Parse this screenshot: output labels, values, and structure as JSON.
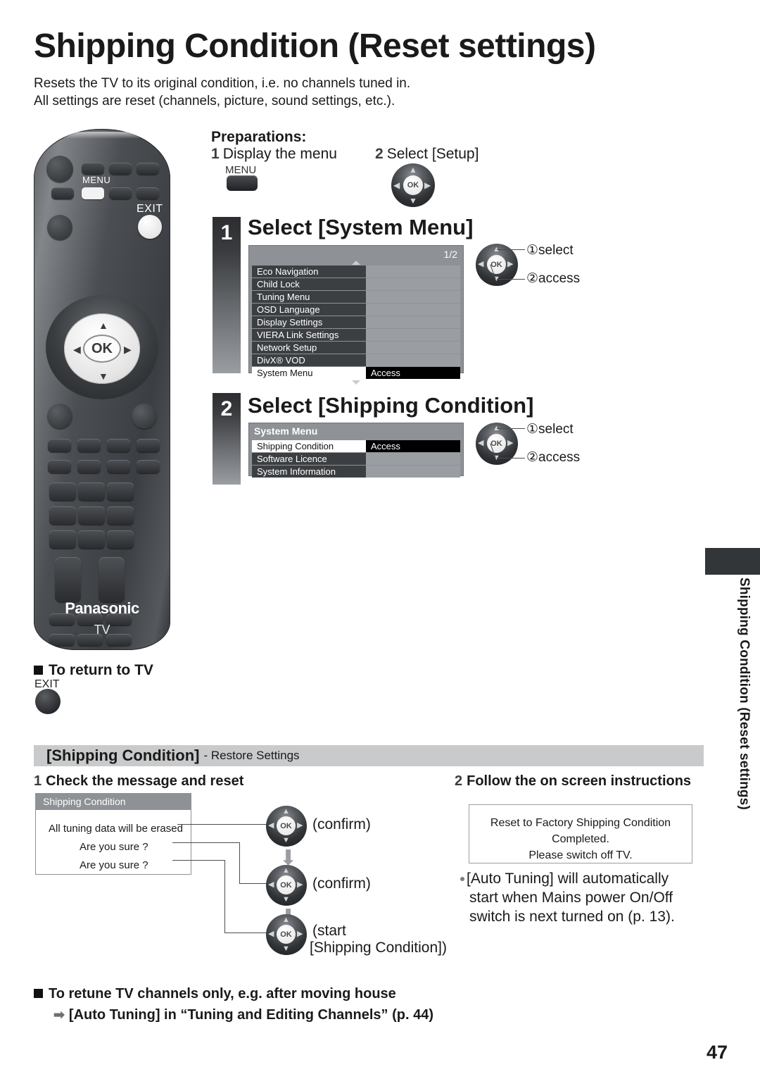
{
  "header": {
    "title": "Shipping Condition (Reset settings)",
    "intro_line1": "Resets the TV to its original condition, i.e. no channels tuned in.",
    "intro_line2": "All settings are reset (channels, picture, sound settings, etc.)."
  },
  "remote": {
    "menu_label": "MENU",
    "exit_label": "EXIT",
    "ok_label": "OK",
    "brand": "Panasonic",
    "brand_sub": "TV"
  },
  "preparations": {
    "title": "Preparations:",
    "step1_num": "1",
    "step1_text": "Display the menu",
    "menu_key_label": "MENU",
    "step2_num": "2",
    "step2_text": "Select [Setup]",
    "ok_label": "OK"
  },
  "step1": {
    "number": "1",
    "heading": "Select [System Menu]",
    "page_indicator": "1/2",
    "rows": [
      {
        "label": "Eco Navigation",
        "value": "",
        "selected": false
      },
      {
        "label": "Child Lock",
        "value": "",
        "selected": false
      },
      {
        "label": "Tuning Menu",
        "value": "",
        "selected": false
      },
      {
        "label": "OSD Language",
        "value": "",
        "selected": false
      },
      {
        "label": "Display Settings",
        "value": "",
        "selected": false
      },
      {
        "label": "VIERA Link Settings",
        "value": "",
        "selected": false
      },
      {
        "label": "Network Setup",
        "value": "",
        "selected": false
      },
      {
        "label": "DivX® VOD",
        "value": "",
        "selected": false
      },
      {
        "label": "System Menu",
        "value": "Access",
        "selected": true
      }
    ],
    "hint1": "①select",
    "hint2": "②access",
    "ok_label": "OK"
  },
  "step2": {
    "number": "2",
    "heading": "Select [Shipping Condition]",
    "screen_title": "System Menu",
    "rows": [
      {
        "label": "Shipping Condition",
        "value": "Access",
        "selected": true
      },
      {
        "label": "Software Licence",
        "value": "",
        "selected": false
      },
      {
        "label": "System Information",
        "value": "",
        "selected": false
      }
    ],
    "hint1": "①select",
    "hint2": "②access",
    "ok_label": "OK"
  },
  "return_to_tv": {
    "heading": "To return to TV",
    "exit_label": "EXIT"
  },
  "bottom_section": {
    "bar_bold": "[Shipping Condition]",
    "bar_rest": "- Restore Settings",
    "left": {
      "num": "1",
      "heading": "Check the message and reset",
      "dialog_title": "Shipping Condition",
      "dialog_line1": "All tuning data will be erased",
      "dialog_line2": "Are you sure ?",
      "dialog_line3": "Are you sure ?",
      "ok_label": "OK",
      "caption1": "(confirm)",
      "caption2": "(confirm)",
      "caption3_line1": "(start",
      "caption3_line2": "[Shipping Condition])"
    },
    "right": {
      "num": "2",
      "heading": "Follow the on screen instructions",
      "msg_line1": "Reset to Factory Shipping Condition",
      "msg_line2": "Completed.",
      "msg_line3": "Please switch off TV.",
      "note_line1": "[Auto Tuning] will automatically",
      "note_line2": "start when Mains power On/Off",
      "note_line3": "switch is next turned on (p. 13)."
    }
  },
  "footer": {
    "line1": "To retune TV channels only, e.g. after moving house",
    "line2": "[Auto Tuning] in “Tuning and Editing Channels” (p. 44)"
  },
  "side": {
    "label": "Shipping Condition (Reset settings)",
    "page_number": "47"
  }
}
